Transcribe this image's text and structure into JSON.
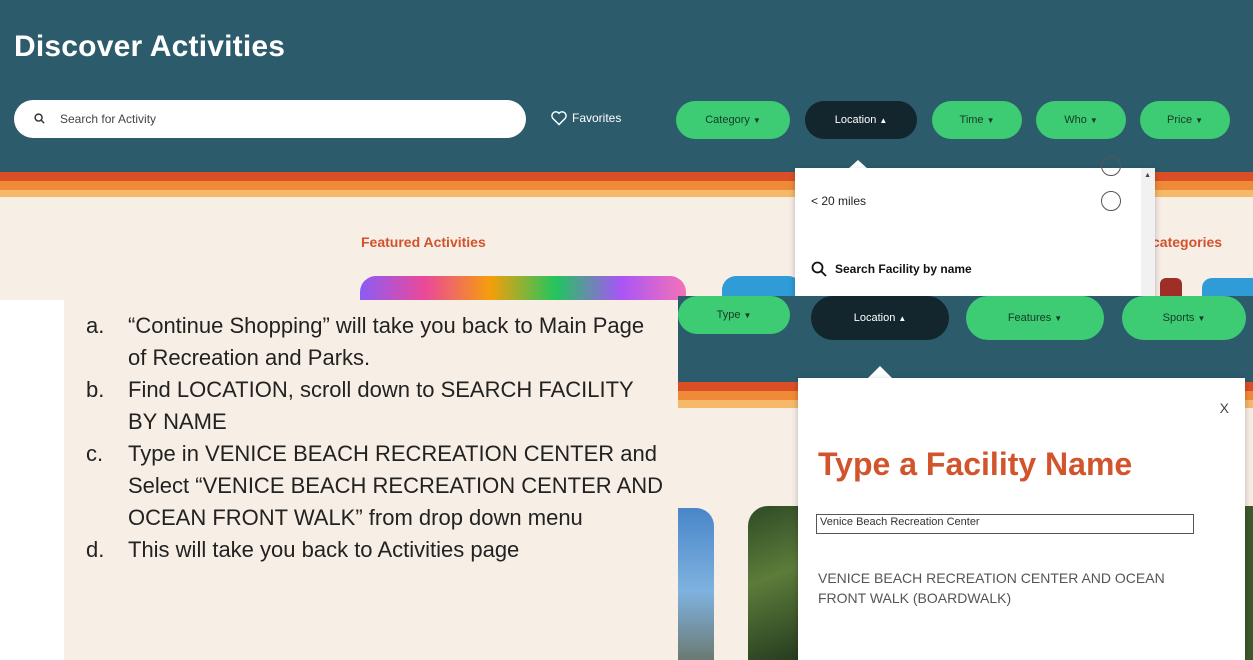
{
  "top": {
    "title": "Discover Activities",
    "search_placeholder": "Search for Activity",
    "favorites_label": "Favorites",
    "filters": [
      {
        "label": "Category",
        "active": false
      },
      {
        "label": "Location",
        "active": true
      },
      {
        "label": "Time",
        "active": false
      },
      {
        "label": "Who",
        "active": false
      },
      {
        "label": "Price",
        "active": false
      }
    ],
    "featured_label": "Featured Activities",
    "categories_label": "categories",
    "location_dropdown": {
      "distance_option": "< 20 miles",
      "search_facility_label": "Search Facility by name"
    }
  },
  "bottom": {
    "filters": [
      {
        "label": "Type",
        "active": false
      },
      {
        "label": "Location",
        "active": true
      },
      {
        "label": "Features",
        "active": false
      },
      {
        "label": "Sports",
        "active": false
      }
    ],
    "facility_panel": {
      "close_label": "X",
      "title": "Type a Facility Name",
      "input_value": "Venice Beach Recreation Center",
      "result": "VENICE BEACH RECREATION CENTER AND OCEAN FRONT WALK (BOARDWALK)"
    }
  },
  "instructions": [
    {
      "marker": "a.",
      "text": "“Continue Shopping” will take you back to Main Page of Recreation and Parks."
    },
    {
      "marker": "b.",
      "text": "Find LOCATION, scroll down to SEARCH FACILITY BY NAME"
    },
    {
      "marker": "c.",
      "text": "Type in VENICE BEACH RECREATION CENTER and Select “VENICE BEACH RECREATION CENTER AND OCEAN FRONT WALK” from drop down menu"
    },
    {
      "marker": "d.",
      "text": "This will take you back to Activities page"
    }
  ],
  "colors": {
    "header_teal": "#2c5b6c",
    "pill_green": "#3dcb73",
    "pill_dark": "#13252d",
    "accent_orange": "#d2542d",
    "page_cream": "#f7efe6"
  }
}
